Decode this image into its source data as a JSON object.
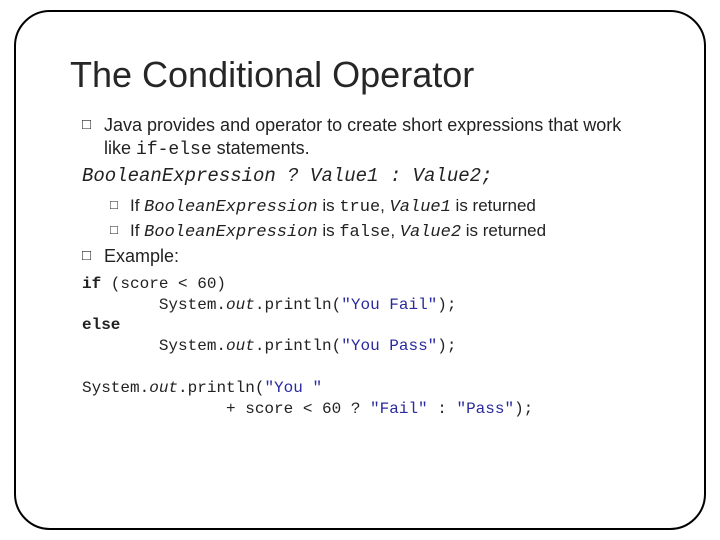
{
  "title": "The Conditional Operator",
  "b1_pre": "Java provides and operator to create short expressions that work like ",
  "b1_code": "if-else",
  "b1_post": " statements.",
  "syntax": "BooleanExpression ? Value1 : Value2;",
  "s1_pre": "If ",
  "s1_expr": "BooleanExpression",
  "s1_mid": " is ",
  "s1_val": "true",
  "s1_mid2": ", ",
  "s1_ret": "Value1",
  "s1_post": " is returned",
  "s2_pre": "If ",
  "s2_expr": "BooleanExpression",
  "s2_mid": " is ",
  "s2_val": "false",
  "s2_mid2": ", ",
  "s2_ret": "Value2",
  "s2_post": " is returned",
  "example_label": "Example:",
  "c1a": "if",
  "c1b": " (score < 60)",
  "c2a": "        System.",
  "c2b": "out",
  "c2c": ".println(",
  "c2d": "\"You Fail\"",
  "c2e": ");",
  "c3a": "else",
  "c4a": "        System.",
  "c4b": "out",
  "c4c": ".println(",
  "c4d": "\"You Pass\"",
  "c4e": ");",
  "c6a": "System.",
  "c6b": "out",
  "c6c": ".println(",
  "c6d": "\"You \"",
  "c7a": "               + score < 60 ? ",
  "c7b": "\"Fail\"",
  "c7c": " : ",
  "c7d": "\"Pass\"",
  "c7e": ");"
}
